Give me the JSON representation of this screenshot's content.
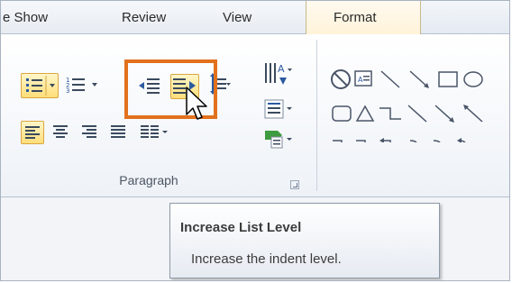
{
  "tabs": {
    "slide_show": "e Show",
    "review": "Review",
    "view": "View",
    "format": "Format"
  },
  "ribbon": {
    "paragraph_group_label": "Paragraph",
    "active_buttons": [
      "bullets",
      "increase-list-level",
      "align-left"
    ]
  },
  "tooltip": {
    "title": "Increase List Level",
    "description": "Increase the indent level."
  },
  "colors": {
    "accent_highlight": "#e2711d",
    "active_button": "#ffde7a",
    "tab_format": "#fff3d9"
  }
}
